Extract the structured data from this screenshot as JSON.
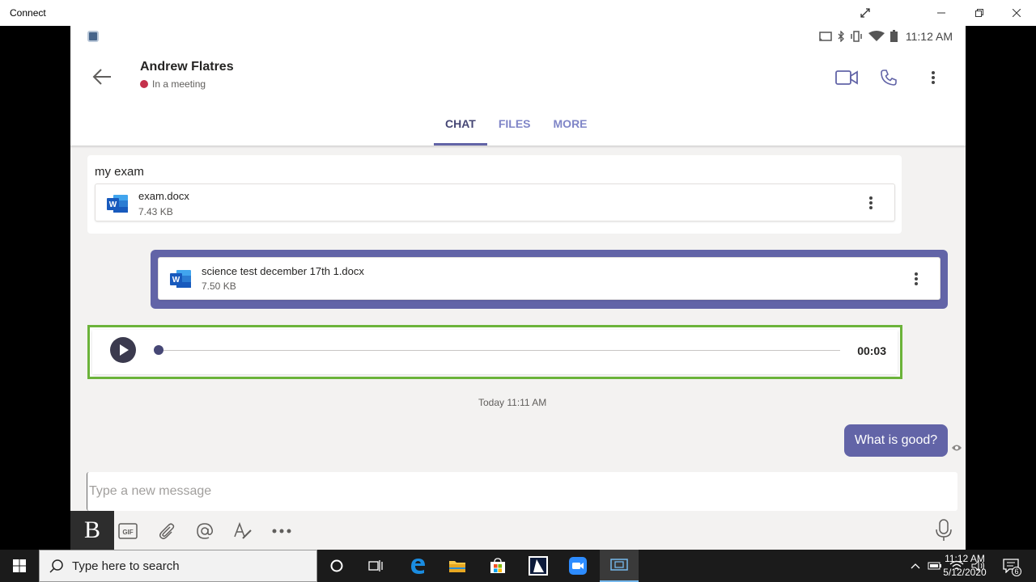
{
  "window": {
    "title": "Connect"
  },
  "statusbar": {
    "time": "11:12 AM"
  },
  "header": {
    "contact_name": "Andrew Flatres",
    "presence": "In a meeting",
    "presence_color": "#c4314b"
  },
  "tabs": [
    {
      "label": "CHAT",
      "active": true
    },
    {
      "label": "FILES",
      "active": false
    },
    {
      "label": "MORE",
      "active": false
    }
  ],
  "messages": {
    "received_text": "my exam",
    "received_file": {
      "name": "exam.docx",
      "size": "7.43 KB"
    },
    "sent_file": {
      "name": "science test december 17th 1.docx",
      "size": "7.50 KB"
    },
    "audio": {
      "duration": "00:03",
      "progress": 0
    },
    "timestamp": "Today 11:11 AM",
    "sent_text": "What is good?"
  },
  "compose": {
    "placeholder": "Type a new message",
    "bold_label": "B"
  },
  "taskbar": {
    "search_placeholder": "Type here to search",
    "clock_time": "11:12 AM",
    "clock_date": "5/12/2020",
    "notification_count": "6"
  },
  "colors": {
    "accent": "#6264a7",
    "highlight_green": "#6bb33a"
  }
}
